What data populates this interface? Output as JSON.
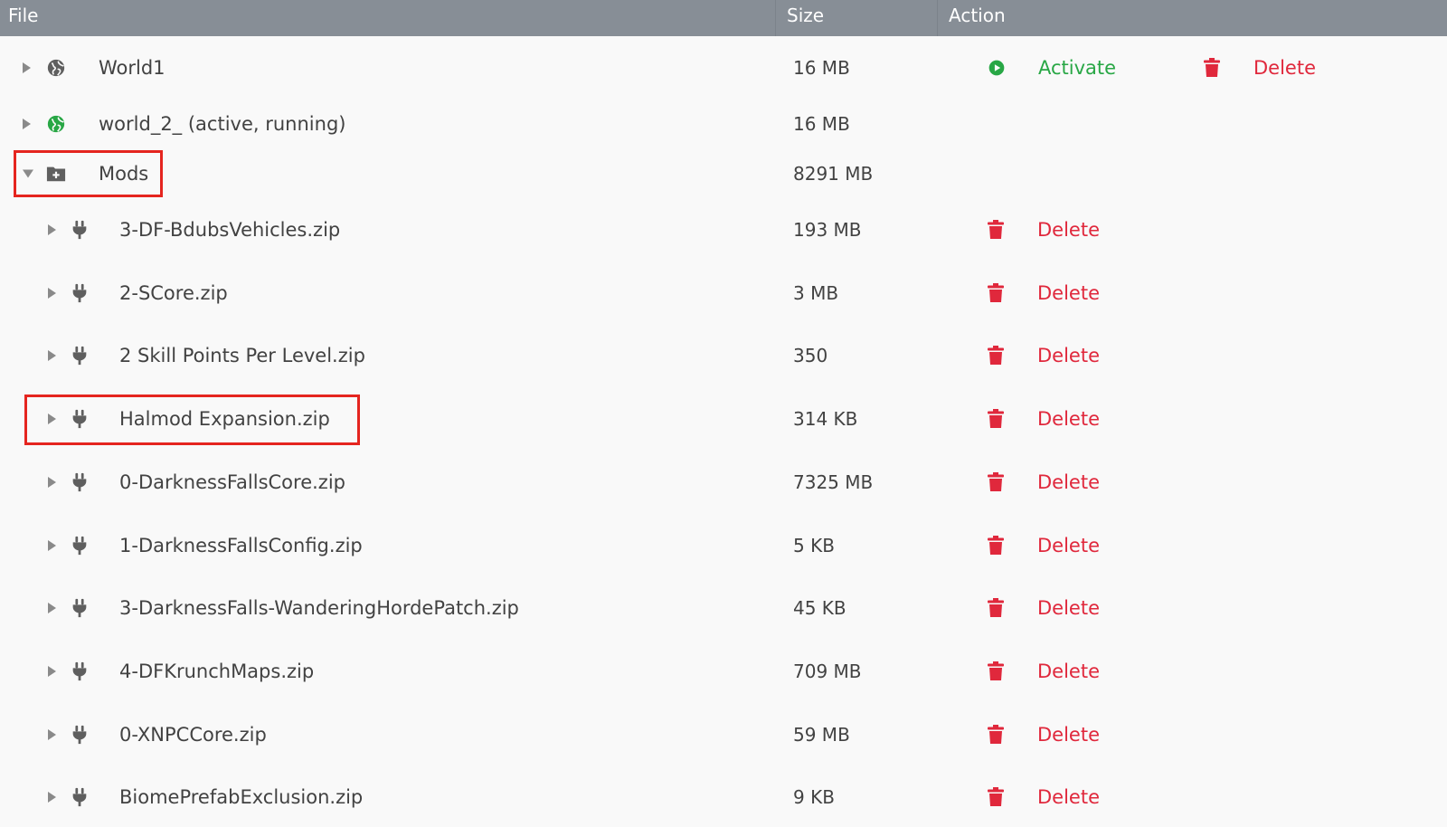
{
  "header": {
    "file_label": "File",
    "size_label": "Size",
    "action_label": "Action"
  },
  "colors": {
    "header_bg": "#878e96",
    "delete": "#e0283c",
    "activate": "#28a745",
    "highlight": "#e5251f"
  },
  "rows": [
    {
      "name": "World1",
      "size": "16 MB",
      "icon": "globe-icon",
      "activate_label": "Activate",
      "delete_label": "Delete"
    },
    {
      "name": "world_2_ (active, running)",
      "size": "16 MB",
      "icon": "globe-icon-active"
    },
    {
      "name": "Mods",
      "size": "8291 MB",
      "icon": "folder-plus-icon",
      "expanded": true
    },
    {
      "name": "3-DF-BdubsVehicles.zip",
      "size": "193 MB",
      "icon": "plug-icon",
      "delete_label": "Delete"
    },
    {
      "name": "2-SCore.zip",
      "size": "3 MB",
      "icon": "plug-icon",
      "delete_label": "Delete"
    },
    {
      "name": "2 Skill Points Per Level.zip",
      "size": "350",
      "icon": "plug-icon",
      "delete_label": "Delete"
    },
    {
      "name": "Halmod Expansion.zip",
      "size": "314 KB",
      "icon": "plug-icon",
      "delete_label": "Delete"
    },
    {
      "name": "0-DarknessFallsCore.zip",
      "size": "7325 MB",
      "icon": "plug-icon",
      "delete_label": "Delete"
    },
    {
      "name": "1-DarknessFallsConfig.zip",
      "size": "5 KB",
      "icon": "plug-icon",
      "delete_label": "Delete"
    },
    {
      "name": "3-DarknessFalls-WanderingHordePatch.zip",
      "size": "45 KB",
      "icon": "plug-icon",
      "delete_label": "Delete"
    },
    {
      "name": "4-DFKrunchMaps.zip",
      "size": "709 MB",
      "icon": "plug-icon",
      "delete_label": "Delete"
    },
    {
      "name": "0-XNPCCore.zip",
      "size": "59 MB",
      "icon": "plug-icon",
      "delete_label": "Delete"
    },
    {
      "name": "BiomePrefabExclusion.zip",
      "size": "9 KB",
      "icon": "plug-icon",
      "delete_label": "Delete"
    }
  ]
}
